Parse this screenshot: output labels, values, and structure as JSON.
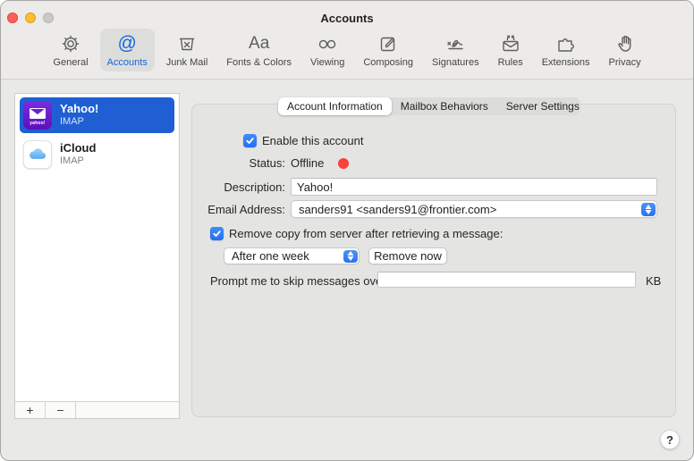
{
  "window": {
    "title": "Accounts"
  },
  "toolbar": {
    "items": [
      {
        "label": "General",
        "icon": "gear-icon",
        "selected": false
      },
      {
        "label": "Accounts",
        "icon": "at-sign-icon",
        "selected": true,
        "glyph": "@"
      },
      {
        "label": "Junk Mail",
        "icon": "junk-bin-icon",
        "selected": false
      },
      {
        "label": "Fonts & Colors",
        "icon": "fonts-aa-icon",
        "selected": false,
        "glyph": "Aa"
      },
      {
        "label": "Viewing",
        "icon": "glasses-icon",
        "selected": false
      },
      {
        "label": "Composing",
        "icon": "compose-icon",
        "selected": false
      },
      {
        "label": "Signatures",
        "icon": "signature-icon",
        "selected": false
      },
      {
        "label": "Rules",
        "icon": "rules-envelope-icon",
        "selected": false
      },
      {
        "label": "Extensions",
        "icon": "puzzle-icon",
        "selected": false
      },
      {
        "label": "Privacy",
        "icon": "hand-icon",
        "selected": false
      }
    ]
  },
  "sidebar": {
    "accounts": [
      {
        "name": "Yahoo!",
        "protocol": "IMAP",
        "icon": "yahoo-mail-icon",
        "selected": true
      },
      {
        "name": "iCloud",
        "protocol": "IMAP",
        "icon": "icloud-cloud-icon",
        "selected": false
      }
    ],
    "add_label": "+",
    "remove_label": "−"
  },
  "tabs": {
    "items": [
      {
        "label": "Account Information",
        "selected": true
      },
      {
        "label": "Mailbox Behaviors",
        "selected": false
      },
      {
        "label": "Server Settings",
        "selected": false
      }
    ]
  },
  "form": {
    "enable_label": "Enable this account",
    "enable_checked": true,
    "status_label": "Status:",
    "status_value": "Offline",
    "status_indicator": "offline-red-dot",
    "description_label": "Description:",
    "description_value": "Yahoo!",
    "email_label": "Email Address:",
    "email_value": "sanders91 <sanders91@frontier.com>",
    "remove_copy_label": "Remove copy from server after retrieving a message:",
    "remove_copy_checked": true,
    "remove_after_value": "After one week",
    "remove_now_label": "Remove now",
    "prompt_label": "Prompt me to skip messages over",
    "prompt_value": "",
    "prompt_unit": "KB"
  },
  "help": {
    "label": "?"
  },
  "colors": {
    "selection_blue": "#1f5fd3",
    "accent_blue": "#1566e0",
    "checkbox_blue": "#2f7cf6",
    "offline_dot_red": "#fc4138",
    "pane_bg": "#e4e4e2",
    "header_bg": "#ecebe9"
  }
}
